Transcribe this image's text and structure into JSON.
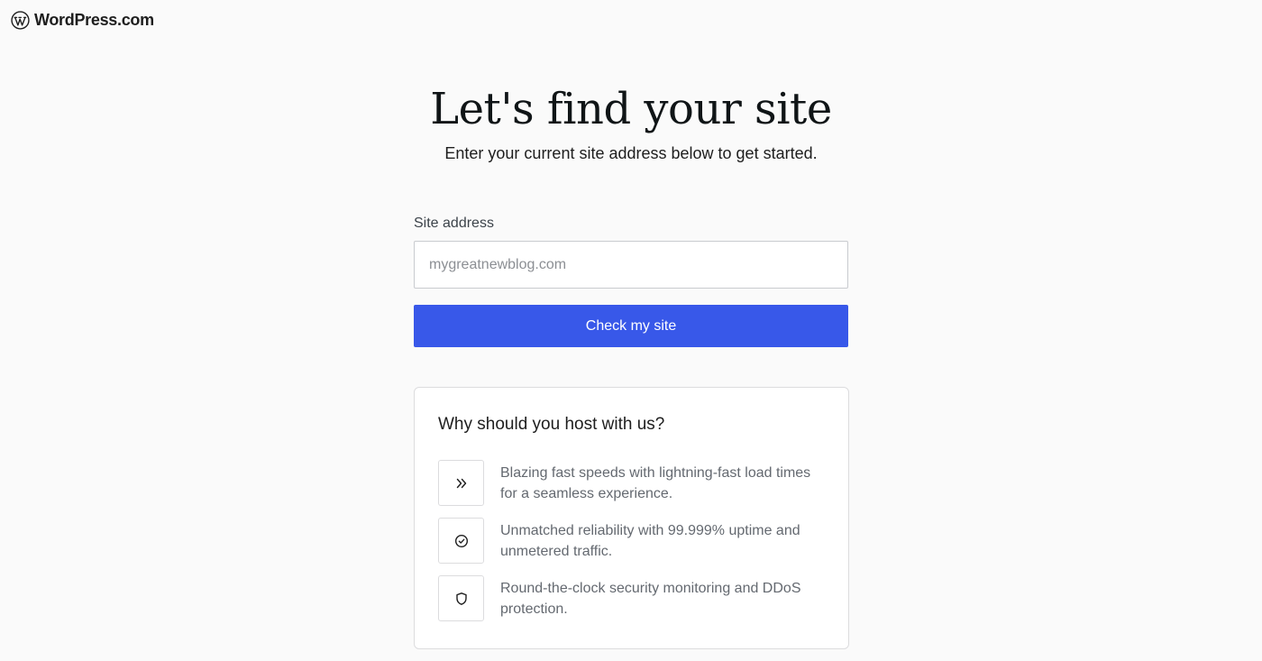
{
  "header": {
    "logo_text": "WordPress.com"
  },
  "main": {
    "title": "Let's find your site",
    "subtitle": "Enter your current site address below to get started."
  },
  "form": {
    "site_label": "Site address",
    "site_placeholder": "mygreatnewblog.com",
    "site_value": "",
    "submit_label": "Check my site"
  },
  "benefits": {
    "title": "Why should you host with us?",
    "items": [
      {
        "icon": "double-chevron-right-icon",
        "text": "Blazing fast speeds with lightning-fast load times for a seamless experience."
      },
      {
        "icon": "check-circle-icon",
        "text": "Unmatched reliability with 99.999% uptime and unmetered traffic."
      },
      {
        "icon": "shield-icon",
        "text": "Round-the-clock security monitoring and DDoS protection."
      }
    ]
  },
  "colors": {
    "accent": "#3858e9",
    "background": "#fafafa",
    "text": "#1e1e1e",
    "muted_text": "#646970"
  }
}
